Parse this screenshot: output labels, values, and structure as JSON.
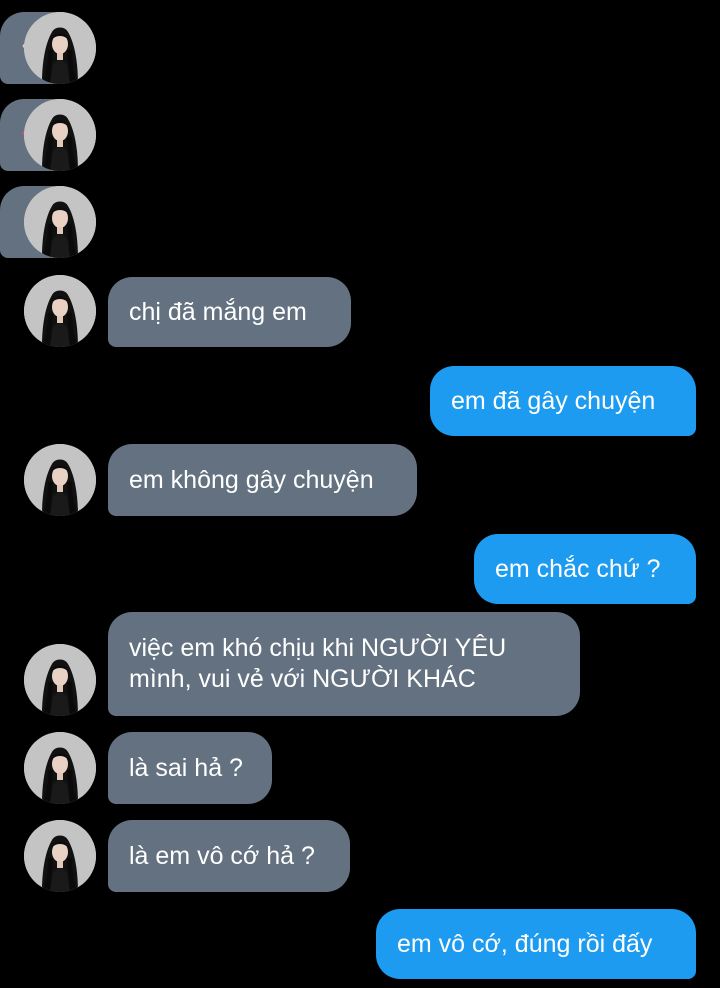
{
  "conversation": {
    "messages": [
      {
        "sender": "them",
        "icon": "eye-icon"
      },
      {
        "sender": "them",
        "icon": "mouth-icon"
      },
      {
        "sender": "them",
        "icon": "raised-hand-icon"
      },
      {
        "sender": "them",
        "text": "chị đã mắng em"
      },
      {
        "sender": "me",
        "text": "em đã gây chuyện"
      },
      {
        "sender": "them",
        "text": "em không gây chuyện"
      },
      {
        "sender": "me",
        "text": "em chắc chứ ?"
      },
      {
        "sender": "them",
        "lines": [
          "việc em khó chịu khi NGƯỜI YÊU",
          "mình, vui vẻ với NGƯỜI KHÁC"
        ]
      },
      {
        "sender": "them",
        "text": "là sai hả ?"
      },
      {
        "sender": "them",
        "text": "là em vô cớ hả ?"
      },
      {
        "sender": "me",
        "text": "em vô cớ, đúng rồi đấy"
      }
    ]
  },
  "colors": {
    "background": "#000000",
    "incoming_bubble": "#647180",
    "outgoing_bubble": "#1d9bf0",
    "text": "#ffffff"
  }
}
